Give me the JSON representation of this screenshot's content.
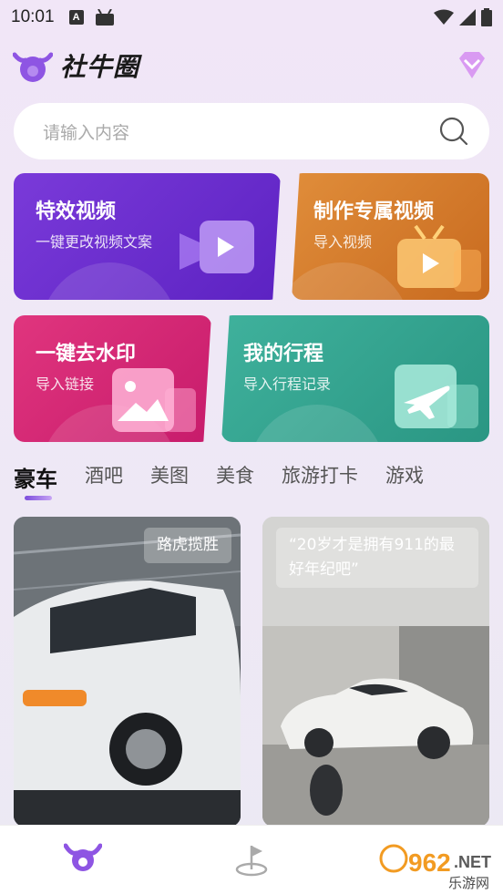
{
  "status": {
    "time": "10:01",
    "a_icon": "A"
  },
  "header": {
    "title": "社牛圈"
  },
  "search": {
    "placeholder": "请输入内容"
  },
  "cards": {
    "video": {
      "title": "特效视频",
      "sub": "一键更改视频文案"
    },
    "make": {
      "title": "制作专属视频",
      "sub": "导入视频"
    },
    "watermark": {
      "title": "一键去水印",
      "sub": "导入链接"
    },
    "trip": {
      "title": "我的行程",
      "sub": "导入行程记录"
    }
  },
  "tabs": [
    "豪车",
    "酒吧",
    "美图",
    "美食",
    "旅游打卡",
    "游戏"
  ],
  "feed": [
    {
      "caption": "路虎揽胜"
    },
    {
      "caption": "“20岁才是拥有911的最好年纪吧”"
    }
  ],
  "watermark_badge": {
    "number": "962",
    "suffix": ".NET",
    "site": "乐游网"
  },
  "colors": {
    "accent": "#7c4ddc",
    "card_video": "#6a2ecf",
    "card_make": "#d67b2c",
    "card_watermark": "#d82876",
    "card_trip": "#35a690"
  }
}
